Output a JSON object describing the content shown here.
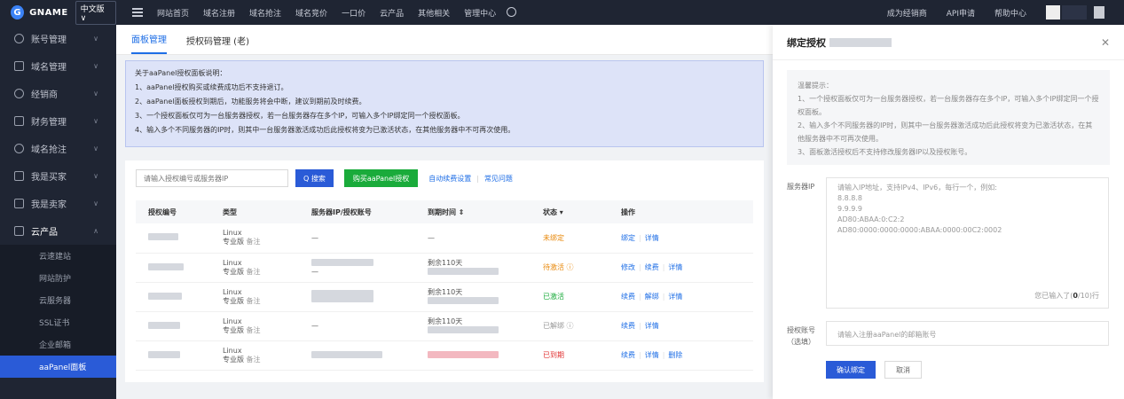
{
  "topbar": {
    "logo_letter": "G",
    "logo_text": "GNAME",
    "lang": "中文版 ∨",
    "nav": [
      "网站首页",
      "域名注册",
      "域名抢注",
      "域名竞价",
      "一口价",
      "云产品",
      "其他相关",
      "管理中心"
    ],
    "right": [
      "成为经销商",
      "API申请",
      "帮助中心"
    ]
  },
  "sidebar": {
    "items": [
      {
        "label": "账号管理"
      },
      {
        "label": "域名管理"
      },
      {
        "label": "经销商"
      },
      {
        "label": "财务管理"
      },
      {
        "label": "域名抢注"
      },
      {
        "label": "我是买家"
      },
      {
        "label": "我是卖家"
      },
      {
        "label": "云产品"
      }
    ],
    "sub_items": [
      "云速建站",
      "网站防护",
      "云服务器",
      "SSL证书",
      "企业邮箱",
      "aaPanel面板"
    ]
  },
  "main": {
    "tabs": [
      "面板管理",
      "授权码管理 (老)"
    ],
    "notice": [
      "关于aaPanel授权面板说明：",
      "1、aaPanel授权购买或续费成功后不支持退订。",
      "2、aaPanel面板授权到期后，功能服务将会中断，建议到期前及时续费。",
      "3、一个授权面板仅可为一台服务器授权，若一台服务器存在多个IP，可输入多个IP绑定同一个授权面板。",
      "4、输入多个不同服务器的IP时，则其中一台服务器激活成功后此授权将变为已激活状态，在其他服务器中不可再次使用。"
    ],
    "search_placeholder": "请输入授权编号或服务器IP",
    "search_btn": "Q 搜索",
    "buy_btn": "购买aaPanel授权",
    "link_renew": "自动续费设置",
    "link_sep": "|",
    "link_faq": "常见问题",
    "columns": [
      "授权编号",
      "类型",
      "服务器IP/授权账号",
      "到期时间 ⇕",
      "状态 ▾",
      "操作"
    ],
    "rows": [
      {
        "type1": "Linux",
        "type2": "专业版",
        "note": "备注",
        "server": "—",
        "expire": "—",
        "status": "未绑定",
        "status_class": "st-orange",
        "ops": [
          "绑定",
          "详情"
        ]
      },
      {
        "type1": "Linux",
        "type2": "专业版",
        "note": "备注",
        "server": "—",
        "expire": "剩余110天",
        "status": "待激活 ⓘ",
        "status_class": "st-orange",
        "ops": [
          "修改",
          "续费",
          "详情"
        ]
      },
      {
        "type1": "Linux",
        "type2": "专业版",
        "note": "备注",
        "server": "",
        "expire": "剩余110天",
        "status": "已激活",
        "status_class": "st-green",
        "ops": [
          "续费",
          "解绑",
          "详情"
        ]
      },
      {
        "type1": "Linux",
        "type2": "专业版",
        "note": "备注",
        "server": "—",
        "expire": "剩余110天",
        "status": "已解绑 ⓘ",
        "status_class": "st-gray",
        "ops": [
          "续费",
          "详情"
        ]
      },
      {
        "type1": "Linux",
        "type2": "专业版",
        "note": "备注",
        "server": "",
        "expire": "",
        "status": "已到期",
        "status_class": "st-red",
        "ops": [
          "续费",
          "详情",
          "删除"
        ]
      }
    ]
  },
  "panel": {
    "title": "绑定授权",
    "close": "✕",
    "tips": [
      "温馨提示：",
      "1、一个授权面板仅可为一台服务器授权，若一台服务器存在多个IP，可输入多个IP绑定同一个授权面板。",
      "2、输入多个不同服务器的IP时，则其中一台服务器激活成功后此授权将变为已激活状态，在其他服务器中不可再次使用。",
      "3、面板激活授权后不支持修改服务器IP以及授权账号。"
    ],
    "server_label": "服务器IP",
    "textarea_lines": [
      "请输入IP地址，支持IPv4、IPv6，每行一个，例如:",
      "8.8.8.8",
      "9.9.9.9",
      "AD80:ABAA:0:C2:2",
      "AD80:0000:0000:0000:ABAA:0000:00C2:0002"
    ],
    "counter_prefix": "您已输入了(",
    "counter_value": "0",
    "counter_suffix": "/10)行",
    "account_label": "授权账号（选填）",
    "account_placeholder": "请输入注册aaPanel的邮箱账号",
    "ok": "确认绑定",
    "cancel": "取消"
  }
}
